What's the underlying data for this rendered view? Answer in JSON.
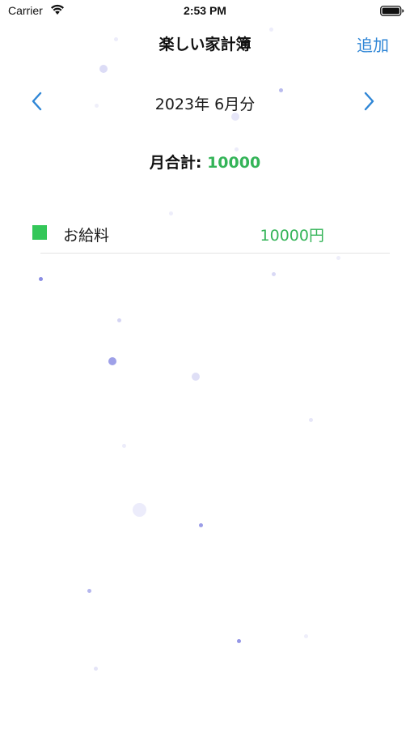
{
  "status_bar": {
    "carrier": "Carrier",
    "time": "2:53 PM",
    "wifi_icon": "wifi-icon",
    "battery_icon": "battery-icon"
  },
  "nav": {
    "title": "楽しい家計簿",
    "add_label": "追加"
  },
  "month_nav": {
    "label": "2023年 6月分",
    "prev_icon": "chevron-left-icon",
    "next_icon": "chevron-right-icon"
  },
  "summary": {
    "label": "月合計:",
    "value": "10000"
  },
  "entries": [
    {
      "name": "お給料",
      "amount": "10000円",
      "color": "#34c759"
    }
  ],
  "colors": {
    "accent": "#2f86d6",
    "income": "#34c759",
    "dot": "#7b7fe0"
  }
}
